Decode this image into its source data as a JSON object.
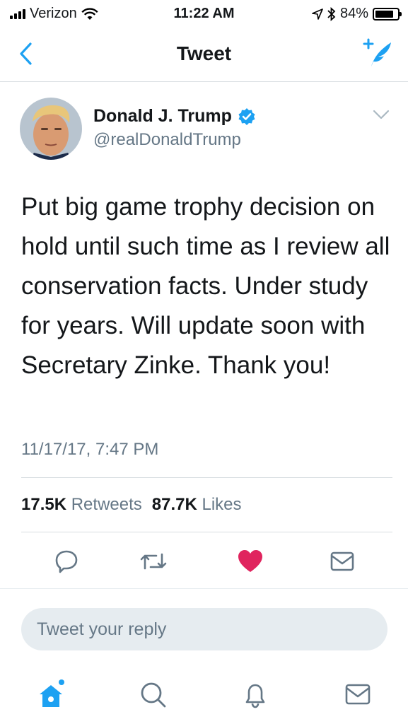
{
  "status_bar": {
    "carrier": "Verizon",
    "time": "11:22 AM",
    "battery_percent": "84%",
    "battery_level": 0.84
  },
  "nav": {
    "title": "Tweet",
    "back_icon": "chevron-left-icon",
    "compose_icon": "compose-tweet-icon"
  },
  "tweet": {
    "author_name": "Donald J. Trump",
    "handle": "@realDonaldTrump",
    "verified": true,
    "text": "Put big game trophy decision on hold until such time as I review all conservation facts. Under study for years. Will update soon with Secretary Zinke. Thank you!",
    "timestamp": "11/17/17, 7:47 PM",
    "retweets_count": "17.5K",
    "retweets_label": "Retweets",
    "likes_count": "87.7K",
    "likes_label": "Likes",
    "liked": true
  },
  "reply": {
    "placeholder": "Tweet your reply"
  },
  "colors": {
    "accent": "#1da1f2",
    "like": "#e0245e",
    "secondary_text": "#657786"
  },
  "tabbar": {
    "items": [
      "home-icon",
      "search-icon",
      "notifications-icon",
      "messages-icon"
    ]
  }
}
